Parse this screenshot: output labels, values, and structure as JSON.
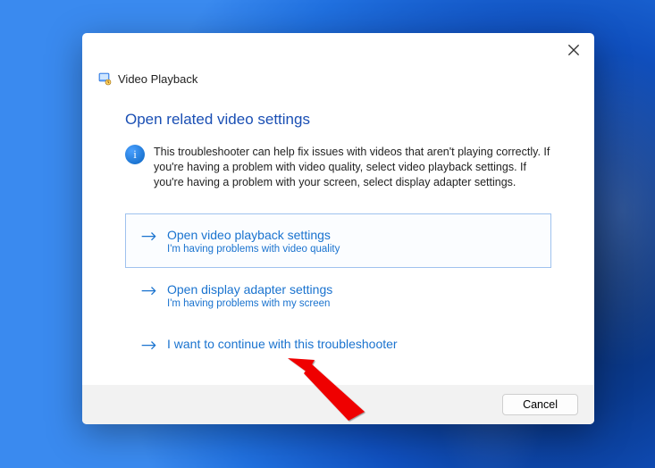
{
  "dialog": {
    "title": "Video Playback",
    "heading": "Open related video settings",
    "info": "This troubleshooter can help fix issues with videos that aren't playing correctly. If you're having a problem with video quality, select video playback settings. If you're having a problem with your screen, select display adapter settings."
  },
  "options": [
    {
      "title": "Open video playback settings",
      "subtitle": "I'm having problems with video quality"
    },
    {
      "title": "Open display adapter settings",
      "subtitle": "I'm having problems with my screen"
    },
    {
      "title": "I want to continue with this troubleshooter",
      "subtitle": ""
    }
  ],
  "footer": {
    "cancel": "Cancel"
  }
}
